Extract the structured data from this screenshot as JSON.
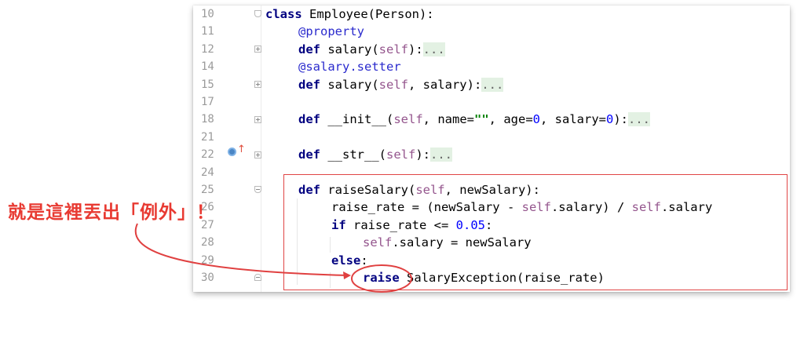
{
  "lines": [
    {
      "num": "10",
      "text": "class Employee(Person):"
    },
    {
      "num": "11",
      "text": "@property"
    },
    {
      "num": "12",
      "text": "def salary(self):..."
    },
    {
      "num": "14",
      "text": "@salary.setter"
    },
    {
      "num": "15",
      "text": "def salary(self, salary):..."
    },
    {
      "num": "17",
      "text": ""
    },
    {
      "num": "18",
      "text": "def __init__(self, name=\"\", age=0, salary=0):..."
    },
    {
      "num": "21",
      "text": ""
    },
    {
      "num": "22",
      "text": "def __str__(self):..."
    },
    {
      "num": "24",
      "text": ""
    },
    {
      "num": "25",
      "text": "def raiseSalary(self, newSalary):"
    },
    {
      "num": "26",
      "text": "raise_rate = (newSalary - self.salary) / self.salary"
    },
    {
      "num": "27",
      "text": "if raise_rate <= 0.05:"
    },
    {
      "num": "28",
      "text": "self.salary = newSalary"
    },
    {
      "num": "29",
      "text": "else:"
    },
    {
      "num": "30",
      "text": "raise SalaryException(raise_rate)"
    }
  ],
  "annotation": {
    "text": "就是這裡丟出「例外」！"
  },
  "colors": {
    "highlight": "#e04545",
    "annotation": "#e83a32"
  }
}
